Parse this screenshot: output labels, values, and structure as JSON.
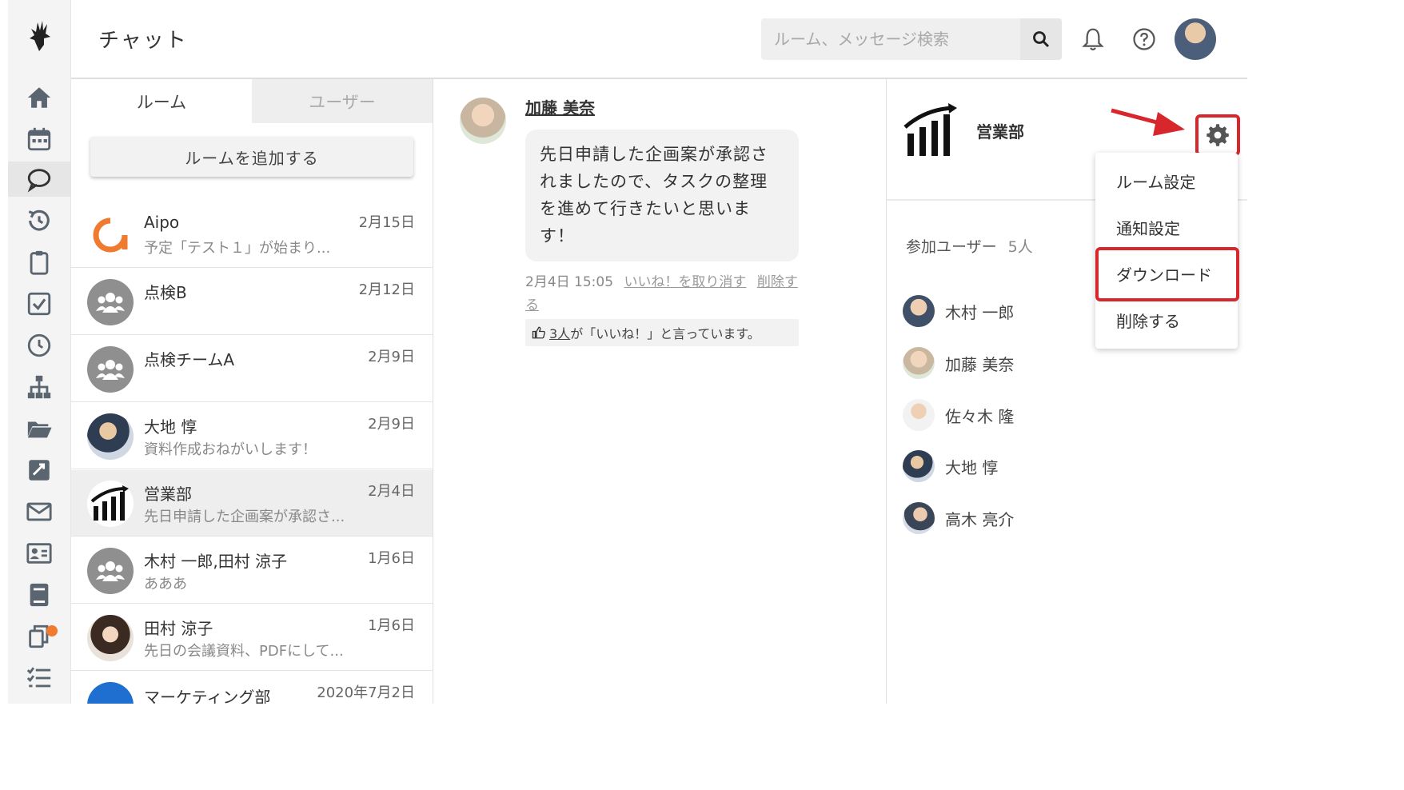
{
  "header": {
    "title": "チャット",
    "search_placeholder": "ルーム、メッセージ検索"
  },
  "room_panel": {
    "tabs": [
      {
        "label": "ルーム",
        "active": true
      },
      {
        "label": "ユーザー",
        "active": false
      }
    ],
    "add_room_label": "ルームを追加する",
    "rooms": [
      {
        "name": "Aipo",
        "date": "2月15日",
        "preview": "予定「テスト１」が始まり...",
        "avatar": "aipo-logo"
      },
      {
        "name": "点検B",
        "date": "2月12日",
        "preview": "",
        "avatar": "group-icon"
      },
      {
        "name": "点検チームA",
        "date": "2月9日",
        "preview": "",
        "avatar": "group-icon"
      },
      {
        "name": "大地 惇",
        "date": "2月9日",
        "preview": "資料作成おねがいします！",
        "avatar": "user-photo"
      },
      {
        "name": "営業部",
        "date": "2月4日",
        "preview": "先日申請した企画案が承認さ...",
        "avatar": "chart-icon",
        "selected": true
      },
      {
        "name": "木村 一郎,田村 涼子",
        "date": "1月6日",
        "preview": "あああ",
        "avatar": "group-icon"
      },
      {
        "name": "田村 涼子",
        "date": "1月6日",
        "preview": "先日の会議資料、PDFにして...",
        "avatar": "user-photo"
      },
      {
        "name": "マーケティング部",
        "date": "2020年7月2日",
        "preview": "",
        "avatar": "blue-icon"
      }
    ]
  },
  "chat": {
    "sender": "加藤 美奈",
    "message": "先日申請した企画案が承認されましたので、タスクの整理を進めて行きたいと思います！",
    "timestamp": "2月4日 15:05",
    "unlike_label": "いいね！を取り消す",
    "delete_label": "削除する",
    "likes_count": "3人",
    "likes_suffix": "が「いいね！」と言っています。"
  },
  "info": {
    "room_name": "営業部",
    "members_label": "参加ユーザー",
    "members_count": "5人",
    "members": [
      {
        "name": "木村 一郎"
      },
      {
        "name": "加藤 美奈"
      },
      {
        "name": "佐々木 隆"
      },
      {
        "name": "大地 惇"
      },
      {
        "name": "高木 亮介"
      }
    ],
    "menu": [
      {
        "label": "ルーム設定"
      },
      {
        "label": "通知設定"
      },
      {
        "label": "ダウンロード"
      },
      {
        "label": "削除する"
      }
    ]
  },
  "colors": {
    "highlight": "#d8262d",
    "aipo_orange": "#f07a30",
    "group_gray": "#8f8f8f"
  }
}
